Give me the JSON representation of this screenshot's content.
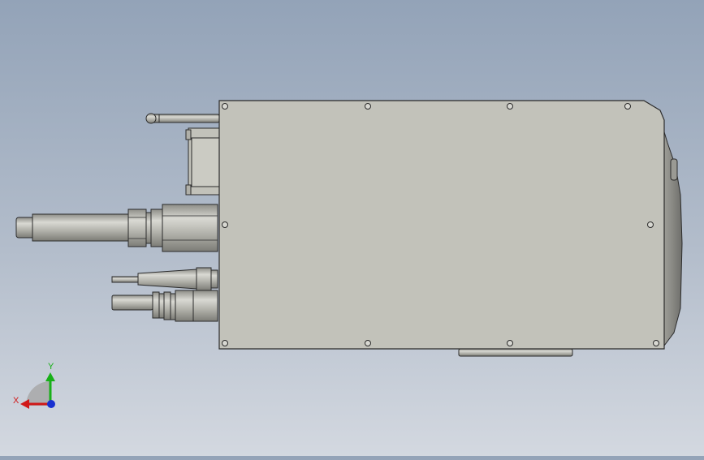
{
  "viewport": {
    "background_top": "#93a3b8",
    "background_bottom": "#d3d8e0",
    "body_color": "#c2c2ba",
    "outline_color": "#2b2b2b",
    "metal_color": "#b9b9b2"
  },
  "triad": {
    "x_label": "X",
    "y_label": "Y",
    "x_color": "#d01818",
    "y_color": "#18b018",
    "z_color": "#1830d0"
  }
}
